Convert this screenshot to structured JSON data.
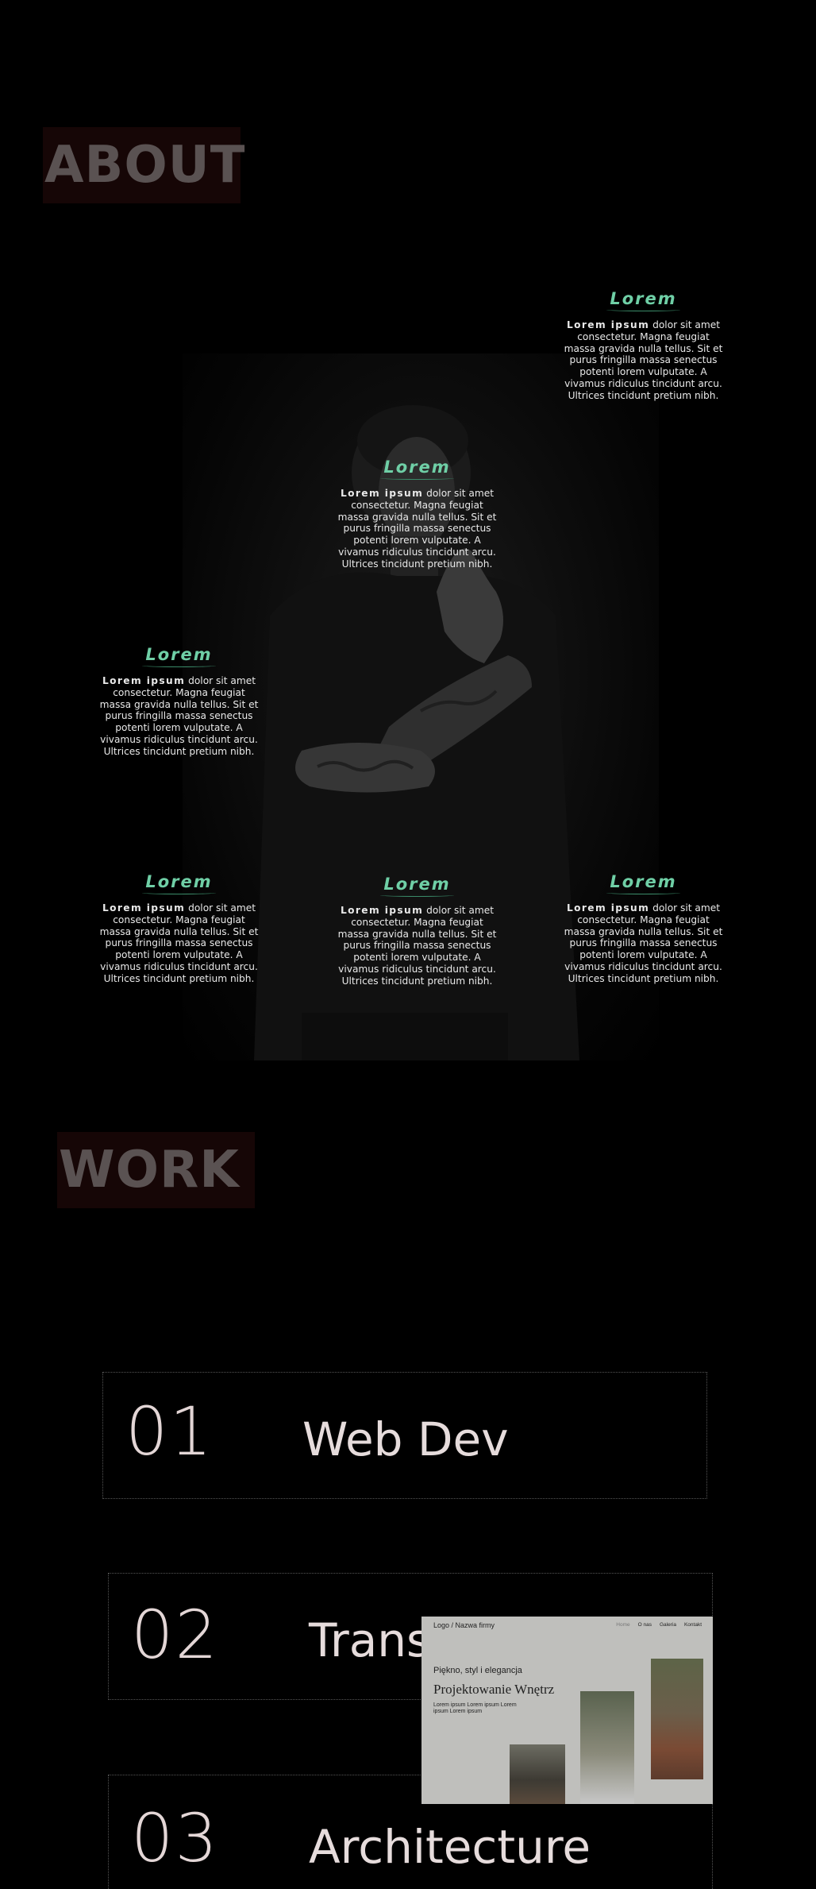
{
  "about": {
    "title": "ABOUT"
  },
  "features": [
    {
      "title": "Lorem",
      "bold": "Lorem ipsum",
      "text": "dolor sit amet consectetur. Magna feugiat massa gravida nulla tellus. Sit et purus fringilla massa senectus potenti lorem vulputate. A vivamus ridiculus tincidunt arcu. Ultrices tincidunt pretium nibh."
    },
    {
      "title": "Lorem",
      "bold": "Lorem ipsum",
      "text": "dolor sit amet consectetur. Magna feugiat massa gravida nulla tellus. Sit et purus fringilla massa senectus potenti lorem vulputate. A vivamus ridiculus tincidunt arcu. Ultrices tincidunt pretium nibh."
    },
    {
      "title": "Lorem",
      "bold": "Lorem ipsum",
      "text": "dolor sit amet consectetur. Magna feugiat massa gravida nulla tellus. Sit et purus fringilla massa senectus potenti lorem vulputate. A vivamus ridiculus tincidunt arcu. Ultrices tincidunt pretium nibh."
    },
    {
      "title": "Lorem",
      "bold": "Lorem ipsum",
      "text": "dolor sit amet consectetur. Magna feugiat massa gravida nulla tellus. Sit et purus fringilla massa senectus potenti lorem vulputate. A vivamus ridiculus tincidunt arcu. Ultrices tincidunt pretium nibh."
    },
    {
      "title": "Lorem",
      "bold": "Lorem ipsum",
      "text": "dolor sit amet consectetur. Magna feugiat massa gravida nulla tellus. Sit et purus fringilla massa senectus potenti lorem vulputate. A vivamus ridiculus tincidunt arcu. Ultrices tincidunt pretium nibh."
    },
    {
      "title": "Lorem",
      "bold": "Lorem ipsum",
      "text": "dolor sit amet consectetur. Magna feugiat massa gravida nulla tellus. Sit et purus fringilla massa senectus potenti lorem vulputate. A vivamus ridiculus tincidunt arcu. Ultrices tincidunt pretium nibh."
    }
  ],
  "work": {
    "title": "WORK",
    "items": [
      {
        "number": "01",
        "label": "Web Dev"
      },
      {
        "number": "02",
        "label": "Transport"
      },
      {
        "number": "03",
        "label": "Architecture"
      }
    ]
  },
  "preview": {
    "logo": "Logo / Nazwa firmy",
    "nav": [
      "Home",
      "O nas",
      "Galeria",
      "Kontakt"
    ],
    "tagline": "Piękno, styl i elegancja",
    "heading": "Projektowanie Wnętrz",
    "description": "Lorem ipsum Lorem ipsum Lorem ipsum Lorem ipsum"
  },
  "colors": {
    "accent": "#6fcfa6",
    "title_bg": "#160606",
    "title_text": "#5a5252"
  }
}
